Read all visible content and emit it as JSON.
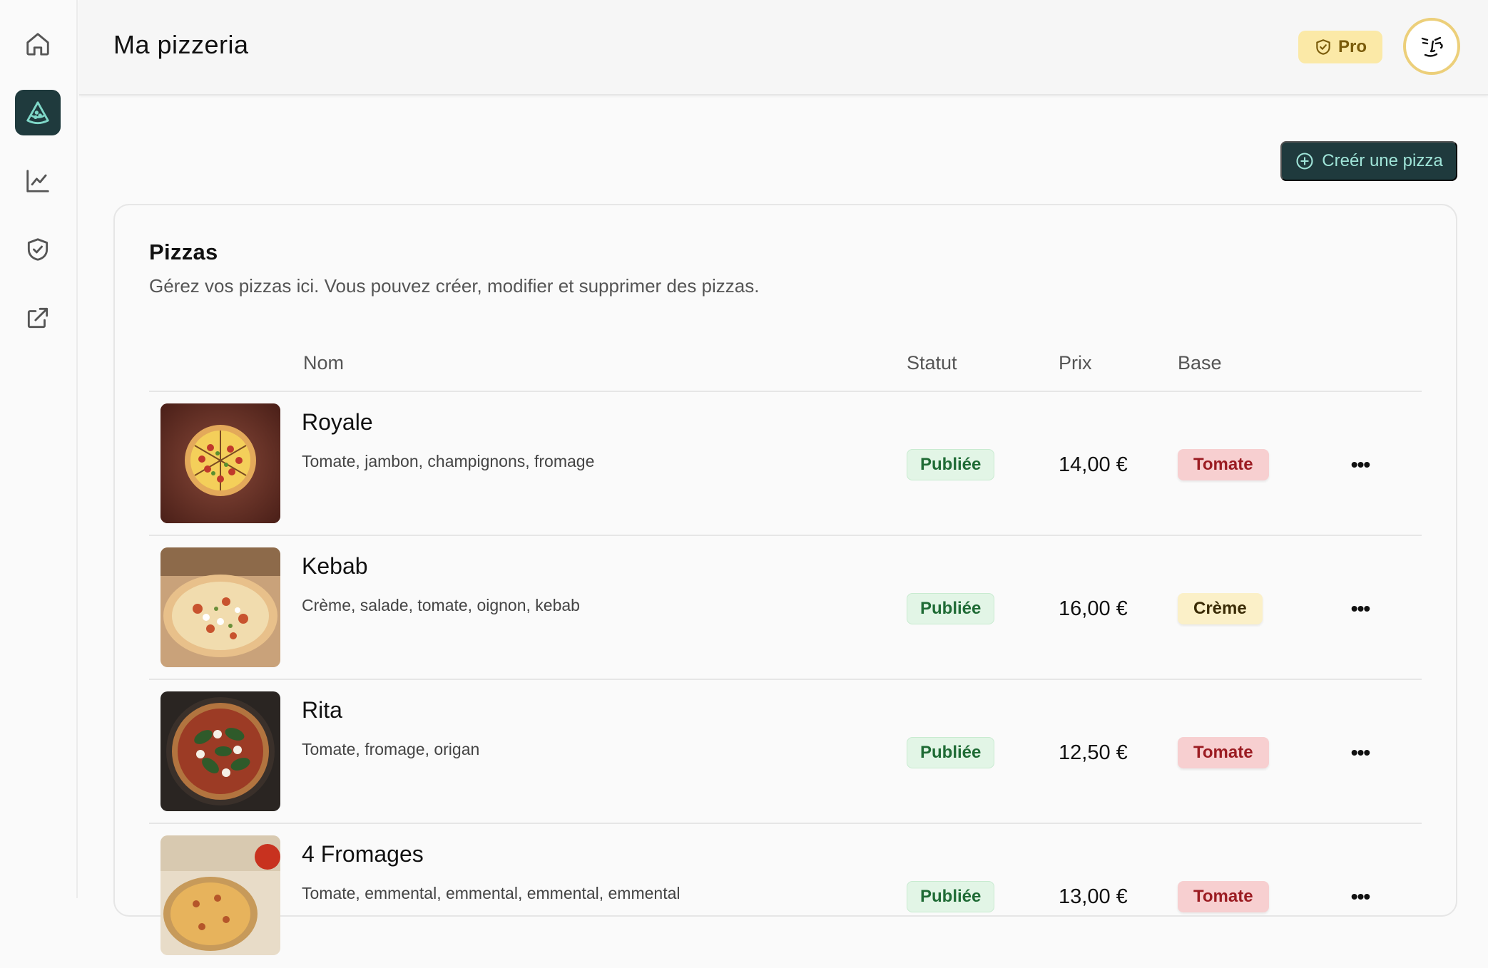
{
  "header": {
    "title": "Ma pizzeria",
    "badge_label": "Pro"
  },
  "sidebar": {
    "items": [
      {
        "name": "home",
        "icon": "home-icon",
        "active": false
      },
      {
        "name": "pizzas",
        "icon": "pizza-slice-icon",
        "active": true
      },
      {
        "name": "analytics",
        "icon": "line-chart-icon",
        "active": false
      },
      {
        "name": "security",
        "icon": "shield-check-icon",
        "active": false
      },
      {
        "name": "external",
        "icon": "external-link-icon",
        "active": false
      }
    ]
  },
  "actions": {
    "create_label": "Creér une pizza"
  },
  "card": {
    "title": "Pizzas",
    "description": "Gérez vos pizzas ici. Vous pouvez créer, modifier et supprimer des pizzas."
  },
  "table": {
    "columns": {
      "name": "Nom",
      "status": "Statut",
      "price": "Prix",
      "base": "Base"
    },
    "rows": [
      {
        "name": "Royale",
        "ingredients": "Tomate, jambon, champignons, fromage",
        "status": "Publiée",
        "price": "14,00 €",
        "base": "Tomate"
      },
      {
        "name": "Kebab",
        "ingredients": "Crème, salade, tomate, oignon, kebab",
        "status": "Publiée",
        "price": "16,00 €",
        "base": "Crème"
      },
      {
        "name": "Rita",
        "ingredients": "Tomate, fromage, origan",
        "status": "Publiée",
        "price": "12,50 €",
        "base": "Tomate"
      },
      {
        "name": "4 Fromages",
        "ingredients": "Tomate, emmental, emmental, emmental, emmental",
        "status": "Publiée",
        "price": "13,00 €",
        "base": "Tomate"
      }
    ],
    "more_label": "•••"
  },
  "colors": {
    "accent": "#1f3a3d",
    "accent_text": "#9fe4d8",
    "pro_badge_bg": "#fbe9a7",
    "status_published_bg": "#e2f5e6",
    "base_tomate_bg": "#f7cfd0",
    "base_creme_bg": "#fbf0c8"
  }
}
